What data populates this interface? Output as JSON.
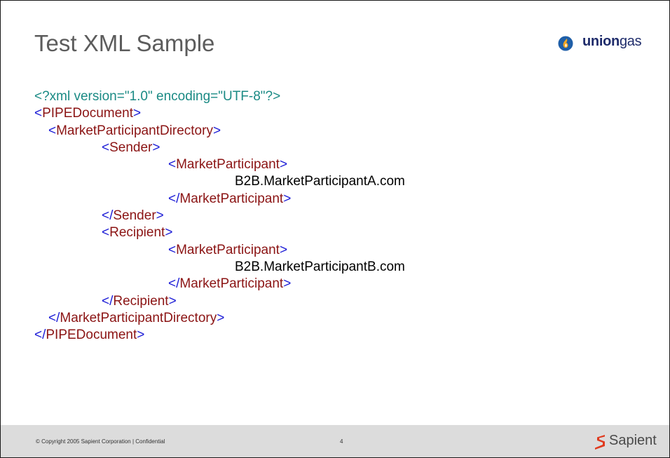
{
  "slide": {
    "title": "Test XML Sample",
    "brand": {
      "icon": "flame-icon",
      "name_bold": "union",
      "name_light": "gas",
      "color": "#1f2c6b"
    },
    "xml": {
      "declaration": "<?xml version=\"1.0\" encoding=\"UTF-8\"?>",
      "root_tag": "PIPEDocument",
      "directory_tag": "MarketParticipantDirectory",
      "sender_tag": "Sender",
      "recipient_tag": "Recipient",
      "participant_tag": "MarketParticipant",
      "sender_value": "B2B.MarketParticipantA.com",
      "recipient_value": "B2B.MarketParticipantB.com",
      "open_bracket": "<",
      "close_bracket": ">",
      "end_open_bracket": "</",
      "colors": {
        "declaration": "#1a8a84",
        "bracket": "#1c1cd6",
        "tag": "#8b1414",
        "value": "#000000"
      }
    },
    "footer": {
      "copyright": "© Copyright 2005 Sapient Corporation | Confidential",
      "page_number": "4",
      "logo_icon": "sapient-s-icon",
      "logo_text": "Sapient",
      "logo_color": "#e03a1e",
      "background": "#dcdcdc"
    }
  }
}
